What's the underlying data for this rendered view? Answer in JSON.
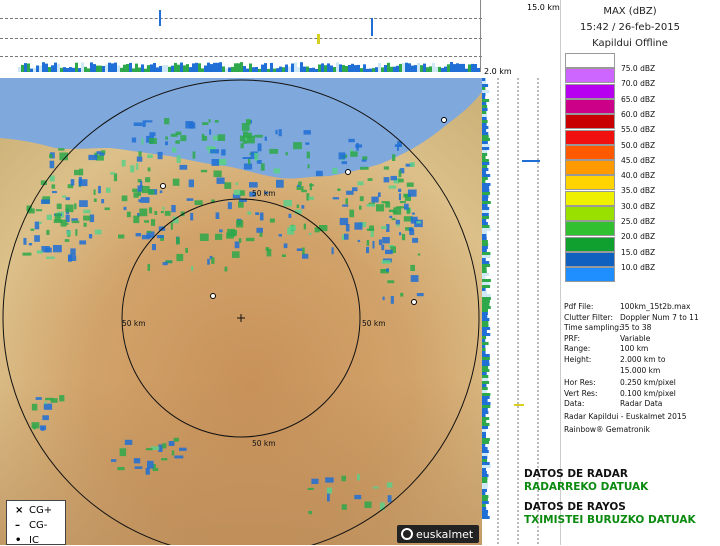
{
  "header": {
    "product": "MAX (dBZ)",
    "datetime": "15:42 / 26-feb-2015",
    "station": "Kapildui Offline"
  },
  "profiles": {
    "top_scale": "15.0 km",
    "side_scale": "2.0 km"
  },
  "range_rings": {
    "label": "50 km",
    "ranges_km": [
      50,
      100
    ]
  },
  "legend": {
    "unit": "dBZ",
    "entries": [
      {
        "label": "75.0 dBZ",
        "color": "#ffffff"
      },
      {
        "label": "70.0 dBZ",
        "color": "#cc66ff"
      },
      {
        "label": "65.0 dBZ",
        "color": "#b800f0"
      },
      {
        "label": "60.0 dBZ",
        "color": "#cc0088"
      },
      {
        "label": "55.0 dBZ",
        "color": "#c80000"
      },
      {
        "label": "50.0 dBZ",
        "color": "#f01010"
      },
      {
        "label": "45.0 dBZ",
        "color": "#ff5a00"
      },
      {
        "label": "40.0 dBZ",
        "color": "#ff9900"
      },
      {
        "label": "35.0 dBZ",
        "color": "#ffd400"
      },
      {
        "label": "30.0 dBZ",
        "color": "#eef000"
      },
      {
        "label": "25.0 dBZ",
        "color": "#99e000"
      },
      {
        "label": "20.0 dBZ",
        "color": "#30c030"
      },
      {
        "label": "15.0 dBZ",
        "color": "#10a030"
      },
      {
        "label": "10.0 dBZ",
        "color": "#1060c0"
      }
    ],
    "bottom_color": "#1f8fff"
  },
  "metadata": [
    {
      "key": "Pdf File:",
      "value": "100km_15t2b.max"
    },
    {
      "key": "Clutter Filter:",
      "value": "Doppler Num 7 to 11"
    },
    {
      "key": "Time sampling:",
      "value": "35 to 38"
    },
    {
      "key": "PRF:",
      "value": "Variable"
    },
    {
      "key": "Range:",
      "value": "100 km"
    },
    {
      "key": "Height:",
      "value": "2.000 km to"
    },
    {
      "key": "",
      "value": "15.000 km"
    },
    {
      "key": "Hor Res:",
      "value": "0.250 km/pixel"
    },
    {
      "key": "Vert Res:",
      "value": "0.100 km/pixel"
    },
    {
      "key": "Data:",
      "value": "Radar Data"
    }
  ],
  "credits": {
    "line1": "Radar Kapildui - Euskalmet 2015",
    "line2": "Rainbow® Gematronik"
  },
  "sections": {
    "radar_es": "DATOS DE RADAR",
    "radar_eu": "RADARREKO DATUAK",
    "rays_es": "DATOS DE RAYOS",
    "rays_eu": "TXIMISTEI BURUZKO DATUAK"
  },
  "lightning_legend": [
    {
      "symbol": "×",
      "label": "CG+"
    },
    {
      "symbol": "–",
      "label": "CG-"
    },
    {
      "symbol": "•",
      "label": "IC"
    }
  ],
  "logo": {
    "text": "euskalmet"
  },
  "colors": {
    "sea": "#7fa8dc",
    "land_light": "#dcc58a",
    "land_mid": "#c99a5f",
    "land_dark": "#a97a48",
    "echo_green": "#2da84a",
    "echo_blue": "#1f6fd6"
  }
}
